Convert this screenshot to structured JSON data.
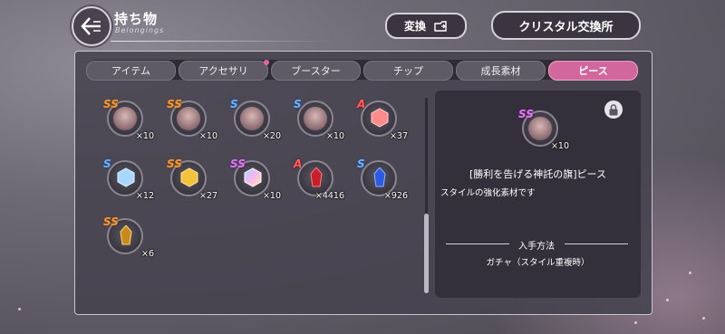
{
  "header": {
    "title": "持ち物",
    "subtitle": "Belongings",
    "convert_label": "変換",
    "crystal_exchange_label": "クリスタル交換所"
  },
  "tabs": [
    {
      "label": "アイテム",
      "active": false
    },
    {
      "label": "アクセサリ",
      "active": false,
      "has_notification": true
    },
    {
      "label": "ブースター",
      "active": false
    },
    {
      "label": "チップ",
      "active": false
    },
    {
      "label": "成長素材",
      "active": false
    },
    {
      "label": "ピース",
      "active": true
    }
  ],
  "items": [
    {
      "rank": "SS",
      "type": "portrait",
      "qty": "×10"
    },
    {
      "rank": "SS",
      "type": "portrait",
      "qty": "×10"
    },
    {
      "rank": "S",
      "type": "portrait",
      "qty": "×20"
    },
    {
      "rank": "S",
      "type": "portrait",
      "qty": "×10"
    },
    {
      "rank": "A",
      "type": "gem-pink",
      "qty": "×37"
    },
    {
      "rank": "S",
      "type": "gem-blue",
      "qty": "×12"
    },
    {
      "rank": "SS",
      "type": "gem-gold",
      "qty": "×27"
    },
    {
      "rank": "SS",
      "type": "gem-rainbow",
      "qty": "×10"
    },
    {
      "rank": "A",
      "type": "crystal-red",
      "qty": "×4416"
    },
    {
      "rank": "S",
      "type": "crystal-blue",
      "qty": "×926"
    },
    {
      "rank": "SS",
      "type": "crystal-gold",
      "qty": "×6"
    }
  ],
  "detail": {
    "rank": "SS",
    "qty": "×10",
    "name": "[勝利を告げる神託の旗]ピース",
    "description": "スタイルの強化素材です",
    "acquisition_title": "入手方法",
    "acquisition_text": "ガチャ（スタイル重複時）"
  },
  "colors": {
    "active_tab": "#d2679d",
    "rank_ss": "#f09a3a",
    "rank_s": "#6fb3ff",
    "rank_a": "#ff5d5d"
  }
}
